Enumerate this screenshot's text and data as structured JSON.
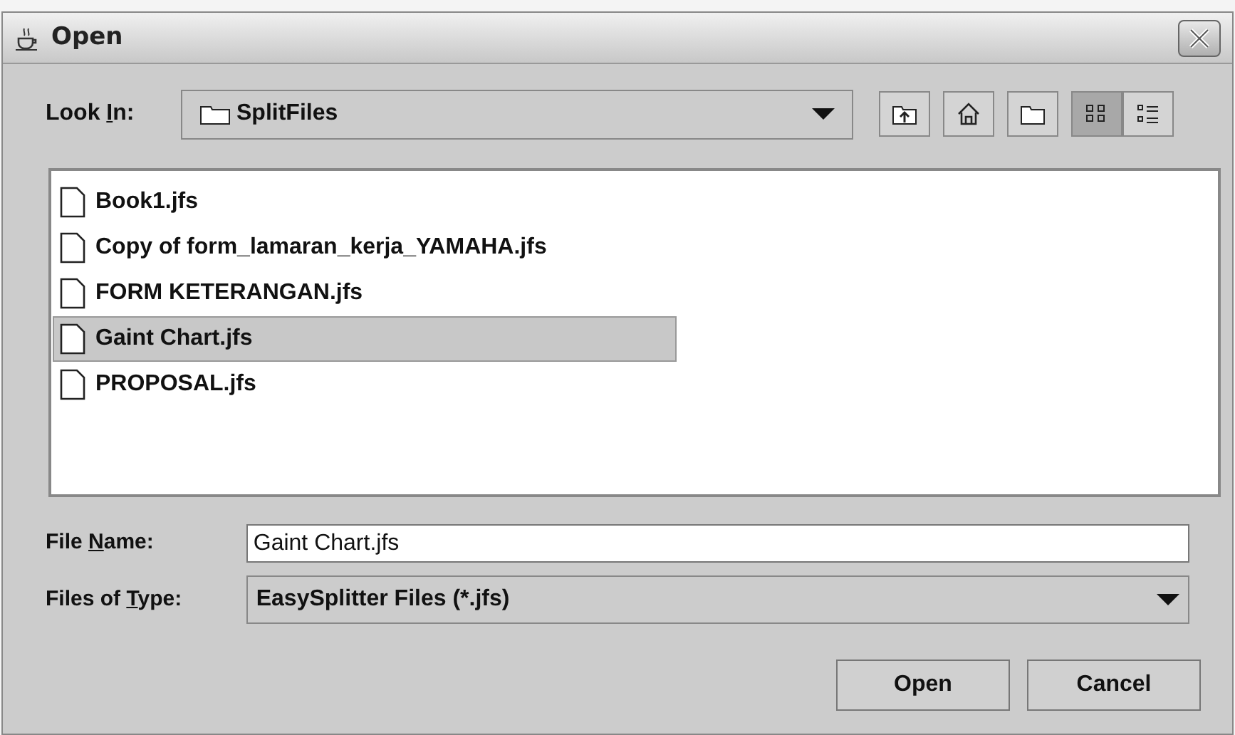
{
  "window": {
    "title": "Open"
  },
  "look_in": {
    "label": {
      "before": "Look ",
      "key": "I",
      "after": "n:"
    },
    "value": "SplitFiles"
  },
  "toolbar": [
    {
      "kind": "up"
    },
    {
      "kind": "home"
    },
    {
      "kind": "new-folder"
    },
    {
      "kind": "list",
      "selected": true
    },
    {
      "kind": "details",
      "selected": false
    }
  ],
  "files": [
    {
      "name": "Book1.jfs",
      "selected": false
    },
    {
      "name": "Copy of form_lamaran_kerja_YAMAHA.jfs",
      "selected": false
    },
    {
      "name": "FORM KETERANGAN.jfs",
      "selected": false
    },
    {
      "name": "Gaint Chart.jfs",
      "selected": true
    },
    {
      "name": "PROPOSAL.jfs",
      "selected": false
    }
  ],
  "file_name": {
    "label": {
      "before": "File ",
      "key": "N",
      "after": "ame:"
    },
    "value": "Gaint Chart.jfs"
  },
  "file_type": {
    "label": {
      "before": "Files of ",
      "key": "T",
      "after": "ype:"
    },
    "value": "EasySplitter Files (*.jfs)"
  },
  "buttons": [
    "Open",
    "Cancel"
  ]
}
